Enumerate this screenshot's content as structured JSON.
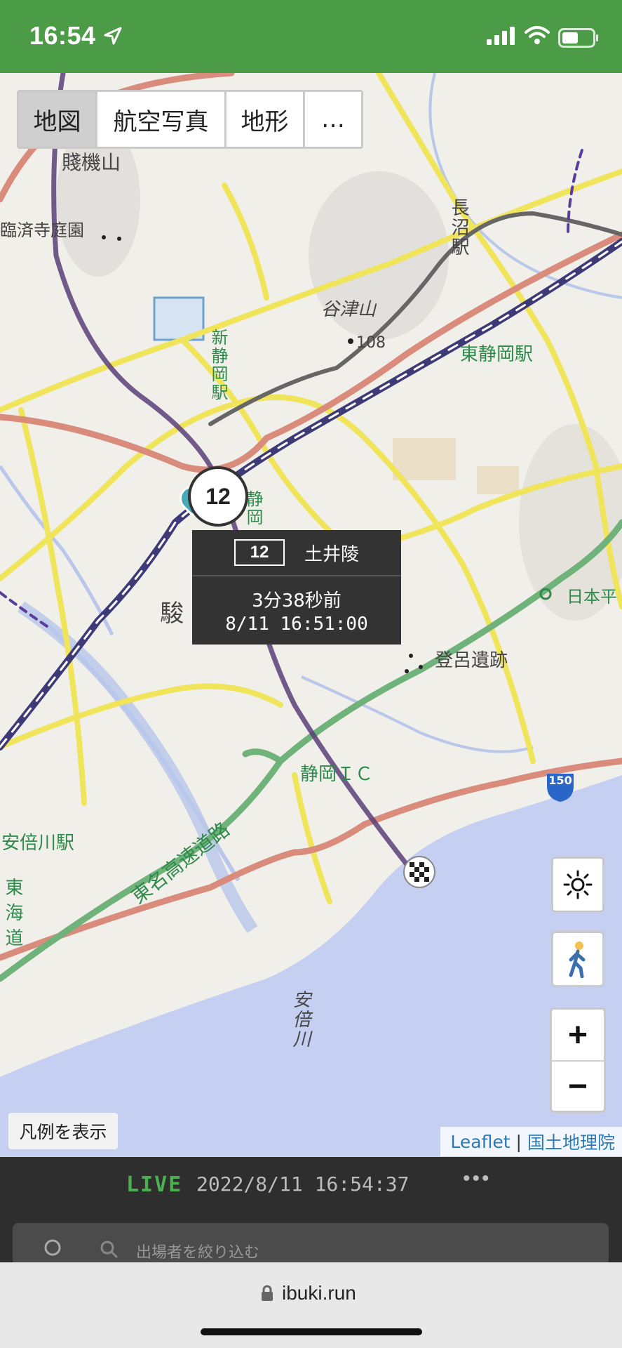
{
  "status_bar": {
    "time": "16:54"
  },
  "map": {
    "layers": [
      {
        "label": "地図",
        "active": true
      },
      {
        "label": "航空写真",
        "active": false
      },
      {
        "label": "地形",
        "active": false
      },
      {
        "label": "…",
        "active": false
      }
    ],
    "labels": {
      "mt_shizuhata": "賤機山",
      "rinzaiji": "臨済寺庭園",
      "nagunuma": "長沼駅",
      "yatsuyama": "谷津山",
      "elev": "108",
      "higashishizuoka": "東静岡駅",
      "shinshizuoka": "新静岡駅",
      "shizuoka_sta": "静岡",
      "suru": "駿",
      "toro": "登呂遺跡",
      "nihondaira": "日本平",
      "shizuoka_ic": "静岡ＩＣ",
      "abekawa_sta": "安倍川駅",
      "tomei": "東名高速道路",
      "tokaido": "東海道",
      "abekawa": "安倍川",
      "route150": "150"
    },
    "marker": {
      "bib": "12"
    },
    "popup": {
      "bib": "12",
      "name": "土井陵",
      "ago": "3分38秒前",
      "timestamp": "8/11 16:51:00"
    },
    "legend_button": "凡例を表示",
    "attribution": {
      "leaflet": "Leaflet",
      "separator": "|",
      "gsi": "国土地理院"
    }
  },
  "panel": {
    "live_label": "LIVE",
    "live_timestamp": "2022/8/11 16:54:37",
    "menu": "•••",
    "search_placeholder": "出場者を絞り込む"
  },
  "browser": {
    "url": "ibuki.run"
  },
  "colors": {
    "status_bar": "#4c9c47",
    "sea": "#c5cff2",
    "expressway": "#6fb27a",
    "route_purple": "#5b3e78",
    "road_yellow": "#f0e45a",
    "road_red": "#d98b7c"
  }
}
